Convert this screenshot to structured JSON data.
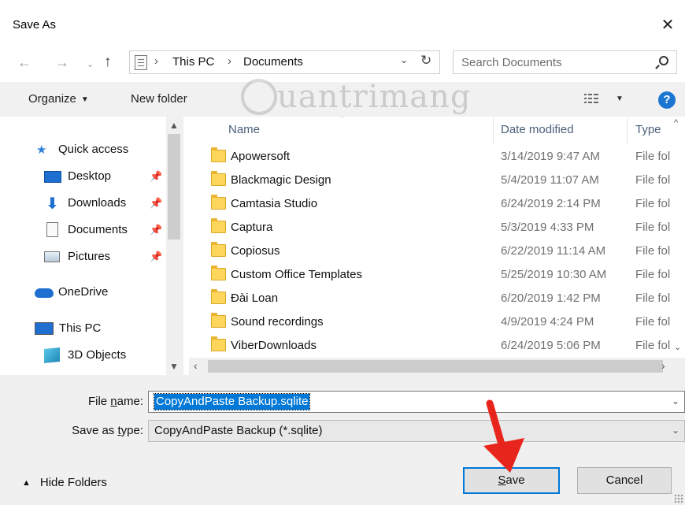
{
  "window": {
    "title": "Save As",
    "close_glyph": "✕"
  },
  "nav_buttons": {
    "back": "←",
    "forward": "→",
    "recent": "⌄",
    "up": "↑"
  },
  "address": {
    "crumbs": [
      "This PC",
      "Documents"
    ],
    "separator": "›",
    "dropdown": "⌄",
    "refresh": "↻"
  },
  "search": {
    "placeholder": "Search Documents"
  },
  "toolbar": {
    "organize": "Organize",
    "new_folder": "New folder",
    "help": "?"
  },
  "watermark": "uantrimang",
  "nav_pane": {
    "items": [
      {
        "label": "Quick access",
        "icon": "star-icon"
      },
      {
        "label": "Desktop",
        "icon": "desktop-icon",
        "pinned": true
      },
      {
        "label": "Downloads",
        "icon": "download-icon",
        "pinned": true
      },
      {
        "label": "Documents",
        "icon": "documents-icon",
        "pinned": true
      },
      {
        "label": "Pictures",
        "icon": "pictures-icon",
        "pinned": true
      },
      {
        "label": "OneDrive",
        "icon": "cloud-icon"
      },
      {
        "label": "This PC",
        "icon": "computer-icon"
      },
      {
        "label": "3D Objects",
        "icon": "cube-icon"
      }
    ]
  },
  "columns": {
    "name": "Name",
    "date": "Date modified",
    "type": "Type"
  },
  "files": [
    {
      "name": "Apowersoft",
      "date": "3/14/2019 9:47 AM",
      "type": "File fol"
    },
    {
      "name": "Blackmagic Design",
      "date": "5/4/2019 11:07 AM",
      "type": "File fol"
    },
    {
      "name": "Camtasia Studio",
      "date": "6/24/2019 2:14 PM",
      "type": "File fol"
    },
    {
      "name": "Captura",
      "date": "5/3/2019 4:33 PM",
      "type": "File fol"
    },
    {
      "name": "Copiosus",
      "date": "6/22/2019 11:14 AM",
      "type": "File fol"
    },
    {
      "name": "Custom Office Templates",
      "date": "5/25/2019 10:30 AM",
      "type": "File fol"
    },
    {
      "name": "Đài Loan",
      "date": "6/20/2019 1:42 PM",
      "type": "File fol"
    },
    {
      "name": "Sound recordings",
      "date": "4/9/2019 4:24 PM",
      "type": "File fol"
    },
    {
      "name": "ViberDownloads",
      "date": "6/24/2019 5:06 PM",
      "type": "File fol"
    }
  ],
  "form": {
    "file_name_label_pre": "File ",
    "file_name_label_u": "n",
    "file_name_label_post": "ame:",
    "file_name_value": "CopyAndPaste Backup.sqlite",
    "type_label_pre": "Save as ",
    "type_label_u": "t",
    "type_label_post": "ype:",
    "type_value": "CopyAndPaste Backup (*.sqlite)"
  },
  "footer": {
    "hide_folders": "Hide Folders",
    "save_u": "S",
    "save_rest": "ave",
    "cancel": "Cancel"
  },
  "colors": {
    "accent": "#0078d7",
    "arrow": "#e8251d",
    "folder": "#ffd65c",
    "help": "#1a76d1"
  }
}
